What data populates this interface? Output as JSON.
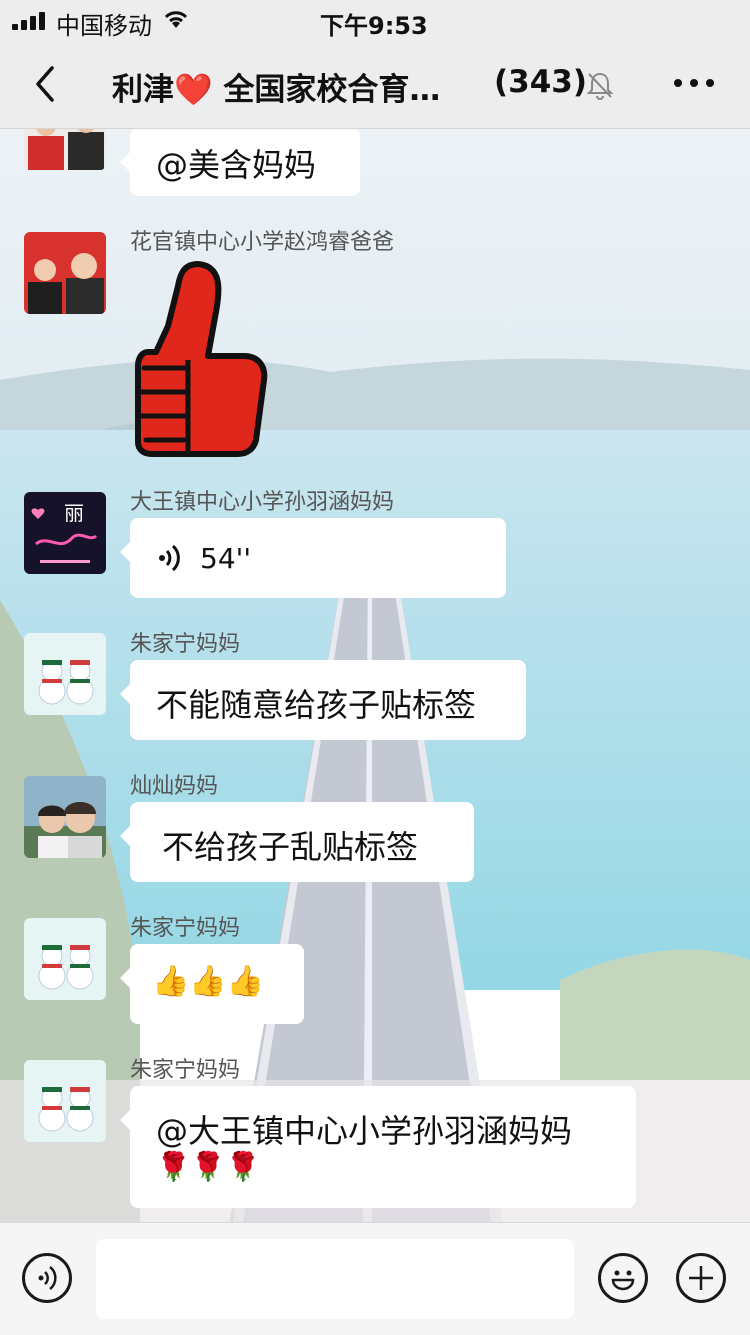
{
  "status_bar": {
    "carrier": "中国移动",
    "time": "下午9:53"
  },
  "nav": {
    "back_icon": "chevron-left-icon",
    "title": "利津❤️ 全国家校合育…",
    "member_count": "(343)",
    "mute_icon": "bell-slash-icon",
    "more_icon": "more-dots-icon"
  },
  "messages": [
    {
      "sender": "",
      "text": "@美含妈妈",
      "type": "text"
    },
    {
      "sender": "花官镇中心小学赵鸿睿爸爸",
      "text": "",
      "type": "sticker",
      "sticker": "thumbs-up-sticker"
    },
    {
      "sender": "大王镇中心小学孙羽涵妈妈",
      "text": "54''",
      "type": "voice",
      "avatar_text": "丽"
    },
    {
      "sender": "朱家宁妈妈",
      "text": "不能随意给孩子贴标签",
      "type": "text"
    },
    {
      "sender": "灿灿妈妈",
      "text": "不给孩子乱贴标签",
      "type": "text"
    },
    {
      "sender": "朱家宁妈妈",
      "text": "👍👍👍",
      "type": "emoji"
    },
    {
      "sender": "朱家宁妈妈",
      "text": "@大王镇中心小学孙羽涵妈妈",
      "text2": "🌹🌹🌹",
      "type": "text"
    }
  ],
  "input_bar": {
    "voice_icon": "voice-toggle-icon",
    "emoji_icon": "emoji-icon",
    "plus_icon": "plus-icon",
    "placeholder": ""
  },
  "colors": {
    "bar_bg": "#ededed",
    "bubble_bg": "#ffffff",
    "sender_text": "#555555"
  }
}
